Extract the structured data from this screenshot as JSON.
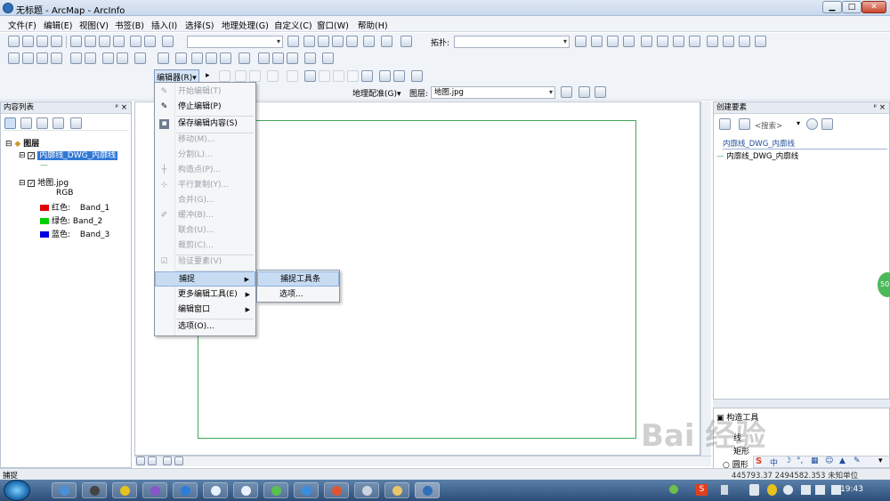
{
  "window": {
    "title": "无标题 - ArcMap - ArcInfo",
    "min": "▁",
    "max": "□",
    "close": "✕"
  },
  "menubar": [
    "文件(F)",
    "编辑(E)",
    "视图(V)",
    "书签(B)",
    "插入(I)",
    "选择(S)",
    "地理处理(G)",
    "自定义(C)",
    "窗口(W)",
    "帮助(H)"
  ],
  "toolbar3": {
    "editor_label": "编辑器(R)▾",
    "georef_label": "地理配准(G)▾",
    "layer_label": "图层:",
    "layer_value": "地图.jpg",
    "topology_label": "拓扑:"
  },
  "toc": {
    "title": "内容列表",
    "pin": "ᵖ ×",
    "layers_label": "图层",
    "layer1": "内廓线_DWG_内廓线",
    "layer1_sym": "—",
    "layer2": "地图.jpg",
    "rgb": "RGB",
    "red": "红色:",
    "green": "绿色:",
    "blue": "蓝色:",
    "band1": "Band_1",
    "band2": "Band_2",
    "band3": "Band_3"
  },
  "editor_menu": {
    "items": [
      "开始编辑(T)",
      "停止编辑(P)",
      "保存编辑内容(S)",
      "移动(M)...",
      "分割(L)...",
      "构造点(P)...",
      "平行复制(Y)...",
      "合并(G)...",
      "缓冲(B)...",
      "联合(U)...",
      "裁剪(C)...",
      "验证要素(V)",
      "捕捉",
      "更多编辑工具(E)",
      "编辑窗口",
      "选项(O)..."
    ]
  },
  "snap_menu": {
    "items": [
      "捕捉工具条",
      "选项..."
    ]
  },
  "create_features": {
    "title": "创建要素",
    "search_placeholder": "<搜索>",
    "group": "内廓线_DWG_内廓线",
    "item": "内廓线_DWG_内廓线"
  },
  "construct_tools": {
    "title": "构造工具",
    "line": "线",
    "rect": "矩形",
    "circle": "圆形"
  },
  "status": {
    "text": "捕捉",
    "coords": "445793.37  2494582.353 未知单位"
  },
  "taskbar": {
    "clock": "19:43"
  },
  "badge": "50",
  "watermark": "Bai 经验",
  "colors": {
    "red": "#e00000",
    "green": "#00d000",
    "blue": "#0000e0",
    "accent": "#2f6fb8",
    "frame": "#3fa65a"
  }
}
